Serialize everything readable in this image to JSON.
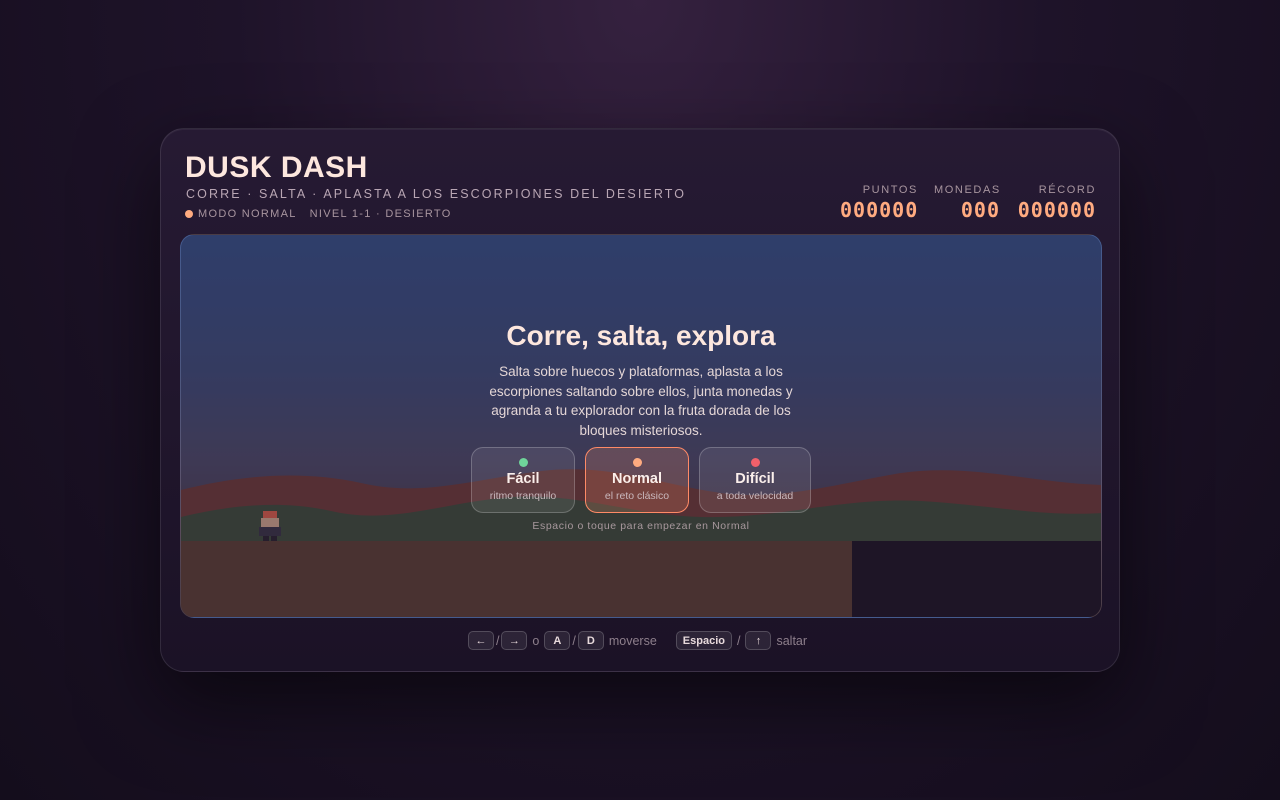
{
  "header": {
    "title": "DUSK DASH",
    "subtitle": "CORRE · SALTA · APLASTA A LOS ESCORPIONES DEL DESIERTO",
    "mode": "MODO NORMAL",
    "level": "NIVEL 1-1 · DESIERTO"
  },
  "stats": [
    {
      "label": "PUNTOS",
      "value": "000000"
    },
    {
      "label": "MONEDAS",
      "value": "000"
    },
    {
      "label": "RÉCORD",
      "value": "000000"
    }
  ],
  "menu": {
    "headline": "Corre, salta, explora",
    "description": "Salta sobre huecos y plataformas, aplasta a los escorpiones saltando sobre ellos, junta monedas y agranda a tu explorador con la fruta dorada de los bloques misteriosos.",
    "difficulties": [
      {
        "name": "Fácil",
        "sub": "ritmo tranquilo",
        "color": "#6fd49a",
        "selected": false
      },
      {
        "name": "Normal",
        "sub": "el reto clásico",
        "color": "#ffab80",
        "selected": true
      },
      {
        "name": "Difícil",
        "sub": "a toda velocidad",
        "color": "#f0606a",
        "selected": false
      }
    ],
    "hint": "Espacio o toque para empezar en Normal"
  },
  "controls": {
    "left_key": "←",
    "right_key": "→",
    "or": "o",
    "a_key": "A",
    "d_key": "D",
    "move": "moverse",
    "space_key": "Espacio",
    "up_key": "↑",
    "jump": "saltar"
  },
  "colors": {
    "accent": "#ffab80",
    "sky_top": "#364e85",
    "ground": "#5a3d35"
  }
}
